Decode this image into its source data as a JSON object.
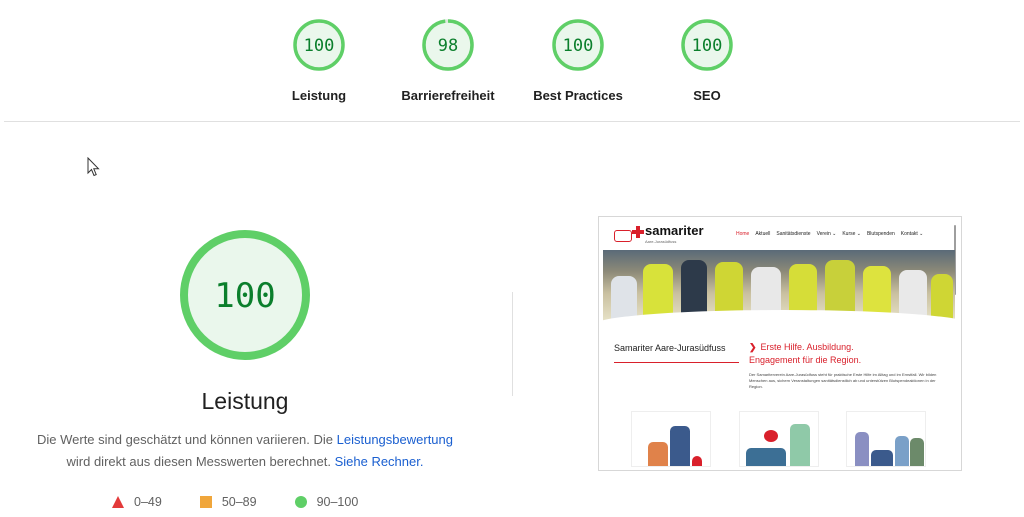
{
  "scores": [
    {
      "label": "Leistung",
      "score": "100",
      "value": 100
    },
    {
      "label": "Barrierefreiheit",
      "score": "98",
      "value": 98
    },
    {
      "label": "Best Practices",
      "score": "100",
      "value": 100
    },
    {
      "label": "SEO",
      "score": "100",
      "value": 100
    }
  ],
  "performance": {
    "score": "100",
    "value": 100,
    "title": "Leistung",
    "desc_part1": "Die Werte sind geschätzt und können variieren. Die ",
    "desc_link1": "Leistungsbewertung",
    "desc_part2": "wird direkt aus diesen Messwerten berechnet. ",
    "desc_link2": "Siehe Rechner."
  },
  "legend": [
    {
      "range": "0–49",
      "shape": "triangle",
      "color": "#e33a3a"
    },
    {
      "range": "50–89",
      "shape": "square",
      "color": "#f0a63b"
    },
    {
      "range": "90–100",
      "shape": "circle",
      "color": "#5fcf67"
    }
  ],
  "colors": {
    "pass_ring": "#5fcf67",
    "pass_fill": "#eaf7ec",
    "pass_text": "#0b7f2c",
    "link": "#1a5fd0",
    "brand_red": "#d9202b"
  },
  "preview": {
    "logo": "samariter",
    "logo_sub": "Aare-Jurasüdfuss",
    "nav": [
      "Home",
      "Aktuell",
      "Sanitätsdienste",
      "Verein ⌄",
      "Kurse ⌄",
      "Blutspenden",
      "Kontakt ⌄"
    ],
    "left_title": "Samariter Aare-Jurasüdfuss",
    "right_title_line1": "Erste Hilfe. Ausbildung.",
    "right_title_line2": "Engagement für die Region.",
    "right_body": "Der Samariterverein Aare-Jurasüdfuss steht für praktische Erste Hilfe im Alltag und im Ernstfall. Wir bilden Menschen aus, sichern Veranstaltungen sanitätsdienstlich ab und unterstützen Blutspendeaktionen in der Region."
  }
}
